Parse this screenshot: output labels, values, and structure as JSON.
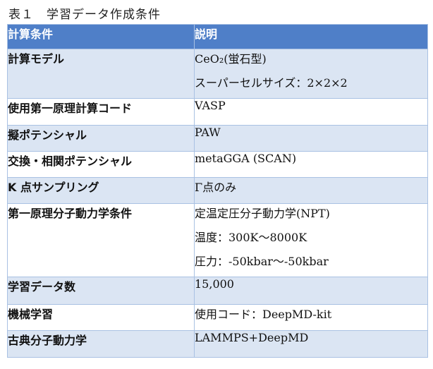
{
  "caption": "表１　学習データ作成条件",
  "header": {
    "col1": "計算条件",
    "col2": "説明"
  },
  "rows": [
    {
      "label": "計算モデル",
      "values": [
        "CeO₂(蛍石型)",
        "スーパーセルサイズ：2×2×2"
      ]
    },
    {
      "label": "使用第一原理計算コード",
      "values": [
        "VASP"
      ]
    },
    {
      "label": "擬ポテンシャル",
      "values": [
        "PAW"
      ]
    },
    {
      "label": "交換・相関ポテンシャル",
      "values": [
        "metaGGA (SCAN)"
      ]
    },
    {
      "label": "K 点サンプリング",
      "values": [
        "Γ点のみ"
      ]
    },
    {
      "label": "第一原理分子動力学条件",
      "values": [
        "定温定圧分子動力学(NPT)",
        "温度：300K～8000K",
        "圧力：-50kbar～-50kbar"
      ]
    },
    {
      "label": "学習データ数",
      "values": [
        "15,000"
      ]
    },
    {
      "label": "機械学習",
      "values": [
        "使用コード：DeepMD-kit"
      ]
    },
    {
      "label": "古典分子動力学",
      "values": [
        "LAMMPS+DeepMD"
      ]
    }
  ]
}
